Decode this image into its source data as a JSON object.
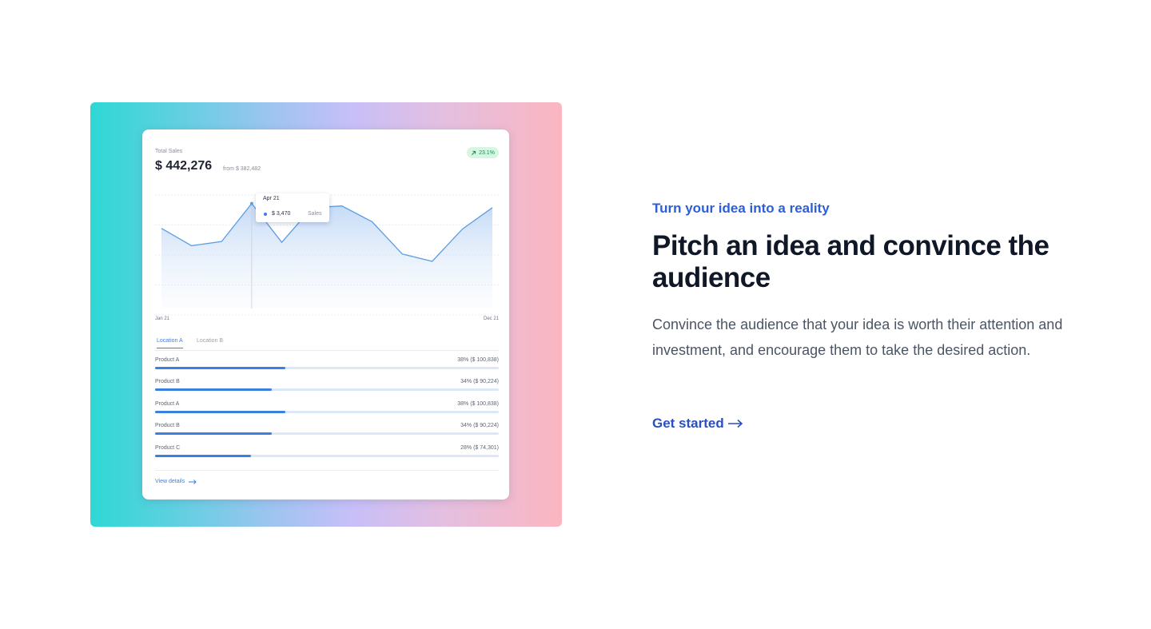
{
  "card": {
    "label": "Total Sales",
    "amount": "$ 442,276",
    "from": "from $ 382,482",
    "badge": "23.1%",
    "badge_icon": "arrow-up-right-icon",
    "tooltip": {
      "date": "Apr 21",
      "value": "$ 3,470",
      "series": "Sales"
    },
    "x_start": "Jan 21",
    "x_end": "Dec 21",
    "tabs": [
      "Location A",
      "Location B"
    ],
    "active_tab": "Location A",
    "rows": [
      {
        "label": "Product A",
        "value": "38% ($ 100,838)",
        "pct": 38
      },
      {
        "label": "Product B",
        "value": "34% ($ 90,224)",
        "pct": 34
      },
      {
        "label": "Product A",
        "value": "38% ($ 100,838)",
        "pct": 38
      },
      {
        "label": "Product B",
        "value": "34% ($ 90,224)",
        "pct": 34
      },
      {
        "label": "Product C",
        "value": "28% ($ 74,301)",
        "pct": 28
      }
    ],
    "view_details": "View details"
  },
  "chart_data": {
    "type": "area",
    "x": [
      1,
      2,
      3,
      4,
      5,
      6,
      7,
      8,
      9,
      10,
      11,
      12
    ],
    "values": [
      3170,
      2960,
      3010,
      3470,
      3000,
      3420,
      3440,
      3250,
      2860,
      2770,
      3160,
      3420
    ],
    "ylim": [
      2200,
      3650
    ],
    "grid": true,
    "color": "#5b9ee0"
  },
  "copy": {
    "eyebrow": "Turn your idea into a reality",
    "headline": "Pitch an idea and convince the audience",
    "body": "Convince the audience that your idea is worth their attention and investment, and encourage them to take the desired action.",
    "cta": "Get started"
  },
  "colors": {
    "accent": "#3b7fe0",
    "cta": "#2a4fc0",
    "eyebrow": "#2c5fd6",
    "headline": "#101828",
    "badge_bg": "#d7f5e3",
    "badge_text": "#1e8f52"
  }
}
